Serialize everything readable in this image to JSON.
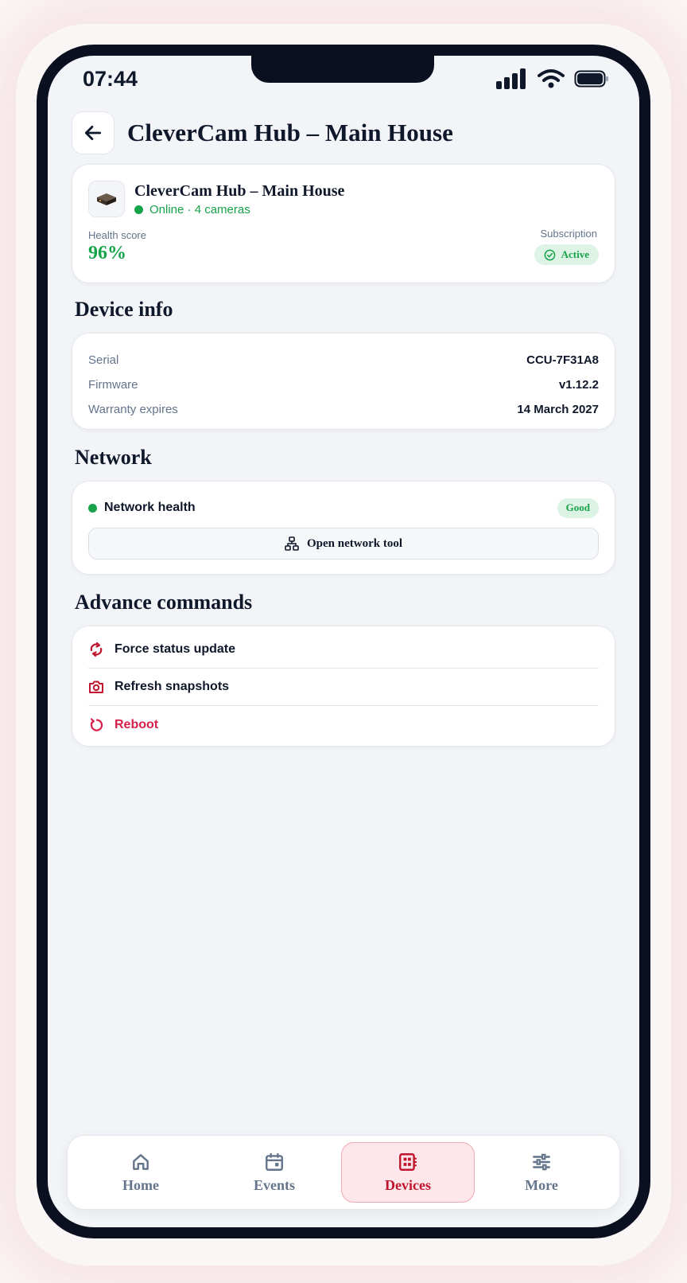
{
  "status_bar": {
    "time": "07:44"
  },
  "header": {
    "title": "CleverCam Hub – Main House"
  },
  "device": {
    "name": "CleverCam Hub – Main House",
    "status": "Online · 4 cameras",
    "health_label": "Health score",
    "health_value": "96%",
    "subscription_label": "Subscription",
    "subscription_status": "Active"
  },
  "device_info": {
    "title": "Device info",
    "rows": [
      {
        "label": "Serial",
        "value": "CCU-7F31A8"
      },
      {
        "label": "Firmware",
        "value": "v1.12.2"
      },
      {
        "label": "Warranty expires",
        "value": "14 March 2027"
      }
    ]
  },
  "network": {
    "title": "Network",
    "health_label": "Network health",
    "health_status": "Good",
    "tool_button": "Open network tool"
  },
  "commands": {
    "title": "Advance commands",
    "items": [
      {
        "label": "Force status update",
        "icon": "sync-icon"
      },
      {
        "label": "Refresh snapshots",
        "icon": "camera-icon"
      },
      {
        "label": "Reboot",
        "icon": "reboot-icon"
      }
    ]
  },
  "tabs": [
    {
      "label": "Home",
      "icon": "home-icon"
    },
    {
      "label": "Events",
      "icon": "calendar-icon"
    },
    {
      "label": "Devices",
      "icon": "devices-icon",
      "active": true
    },
    {
      "label": "More",
      "icon": "sliders-icon"
    }
  ],
  "colors": {
    "accent": "#c0142f",
    "success": "#16a34a",
    "danger": "#d61f4a"
  }
}
